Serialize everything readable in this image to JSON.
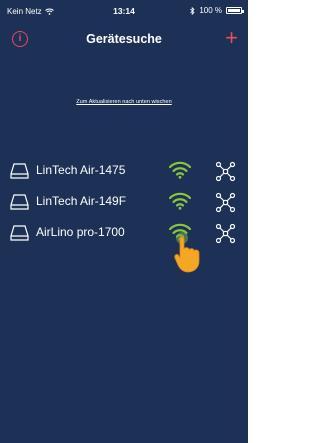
{
  "status_bar": {
    "carrier": "Kein Netz",
    "time": "13:14",
    "battery_text": "100 %",
    "battery_level": 1.0
  },
  "nav": {
    "title": "Gerätesuche",
    "info_label": "i",
    "add_label": "+"
  },
  "hint": "Zum Aktualisieren nach unten wischen",
  "devices": [
    {
      "name": "LinTech Air-1475",
      "icon": "drive-icon",
      "signal_icon": "wifi-icon",
      "action_icon": "network-connect-icon"
    },
    {
      "name": "LinTech Air-149F",
      "icon": "drive-icon",
      "signal_icon": "wifi-icon",
      "action_icon": "network-connect-icon"
    },
    {
      "name": "AirLino pro-1700",
      "icon": "drive-icon",
      "signal_icon": "wifi-icon",
      "action_icon": "network-connect-icon"
    }
  ],
  "colors": {
    "background": "#1c3155",
    "accent_red": "#e94b60",
    "signal_green": "#8bc53f",
    "hand_orange": "#f5a623"
  }
}
